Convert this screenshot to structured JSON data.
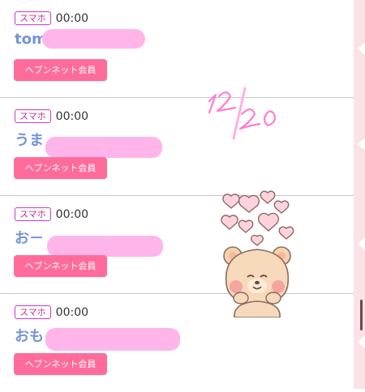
{
  "entries": [
    {
      "device": "スマホ",
      "time": "00:00",
      "name_visible": "tom",
      "member_label": "ヘブンネット会員"
    },
    {
      "device": "スマホ",
      "time": "00:00",
      "name_visible": "うま",
      "member_label": "ヘブンネット会員"
    },
    {
      "device": "スマホ",
      "time": "00:00",
      "name_visible": "お－",
      "member_label": "ヘブンネット会員"
    },
    {
      "device": "スマホ",
      "time": "00:00",
      "name_visible": "おも",
      "member_label": "ヘブンネット会員"
    }
  ],
  "sticker": {
    "handwritten_date": "12/20",
    "icon": "bear-with-hearts-icon"
  },
  "colors": {
    "accent": "#ff6c9b",
    "name": "#7594d8",
    "badge": "#c63cc2",
    "redaction": "#ffb5ea",
    "rail": "#fbe2e7"
  }
}
